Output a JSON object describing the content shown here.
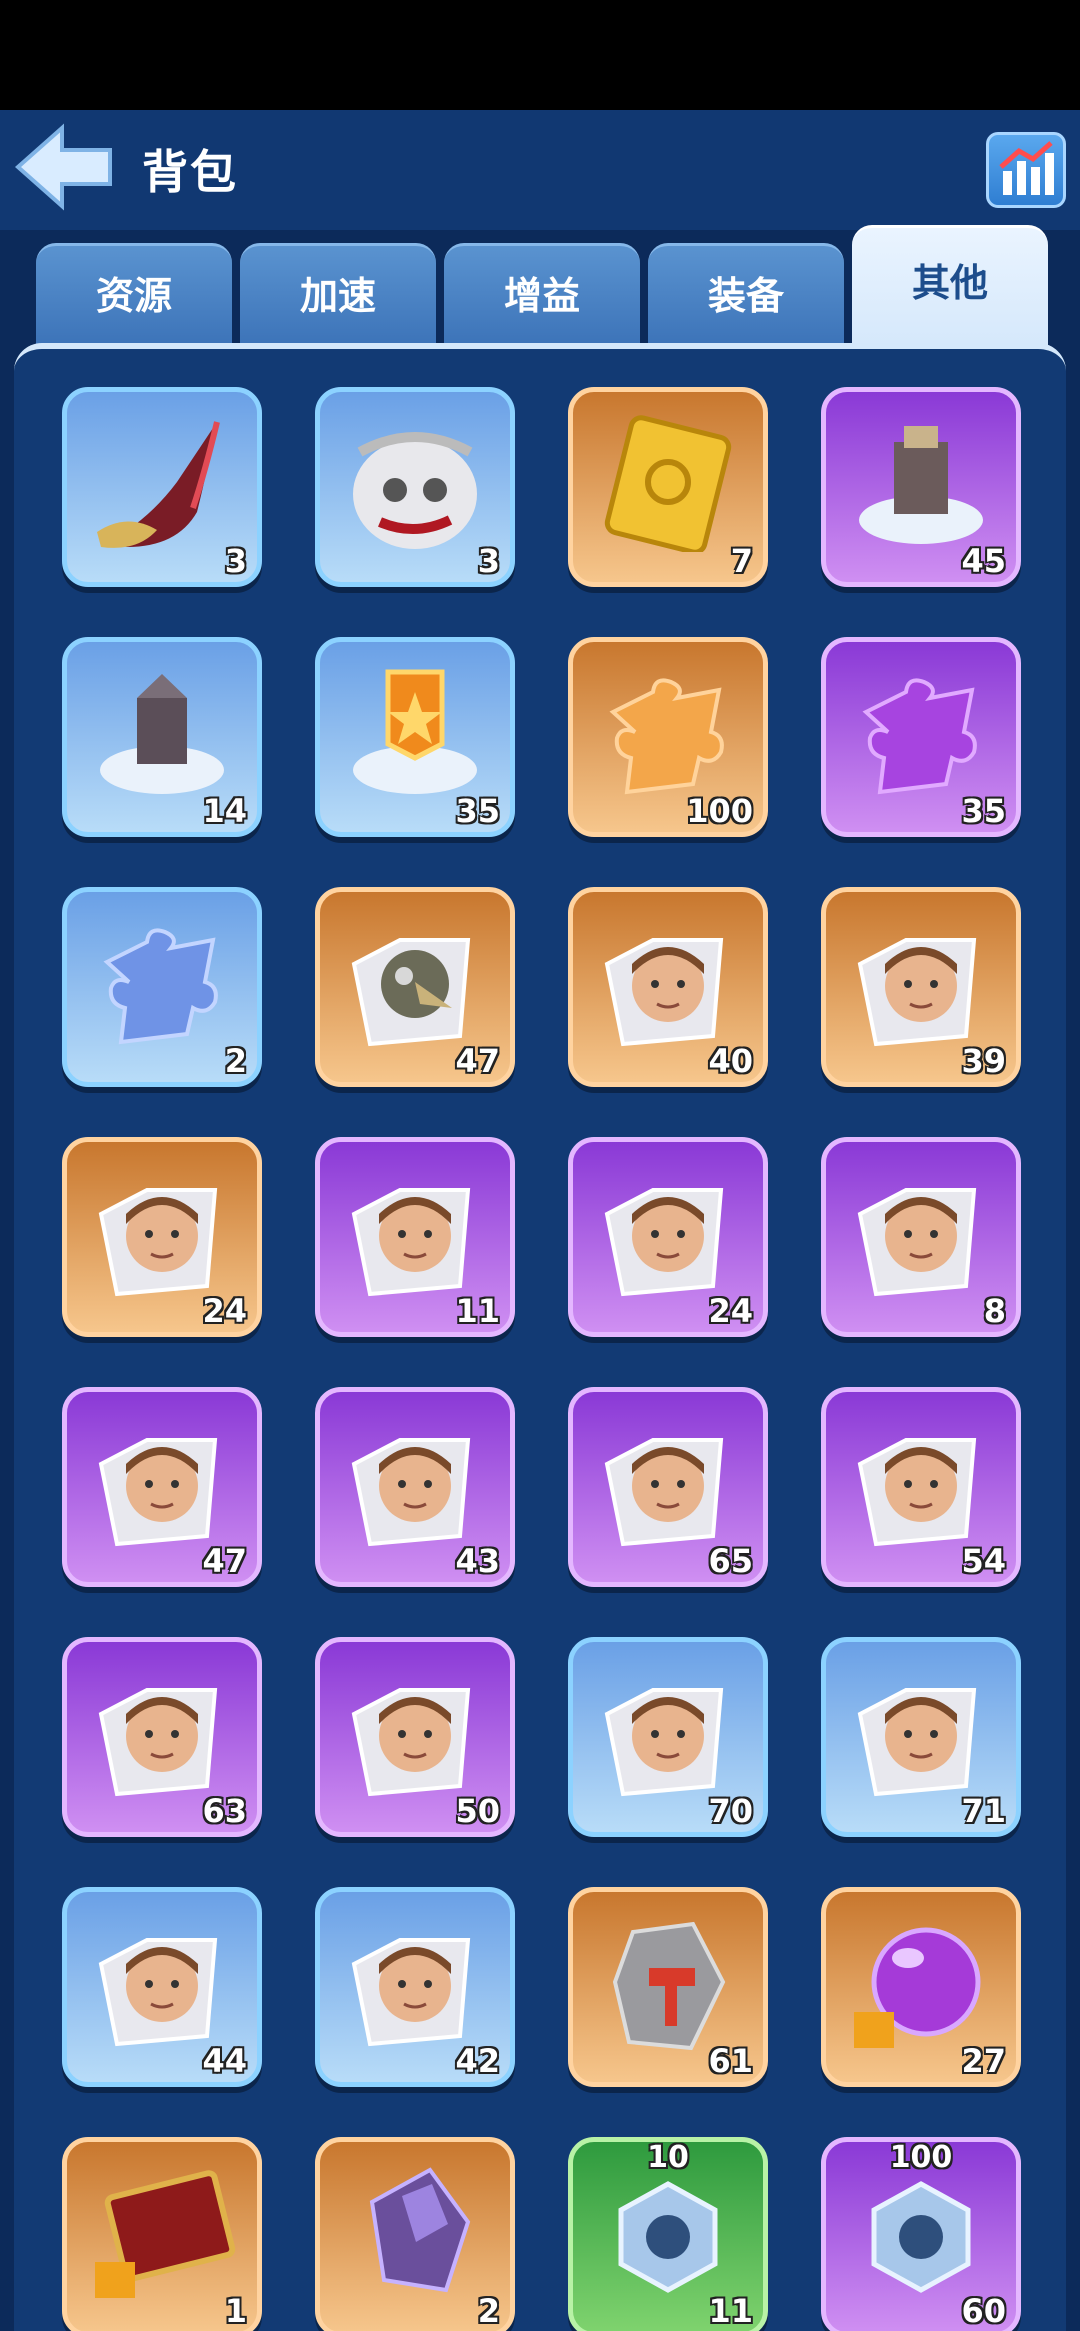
{
  "header": {
    "title": "背包"
  },
  "tabs": [
    {
      "label": "资源"
    },
    {
      "label": "加速"
    },
    {
      "label": "增益"
    },
    {
      "label": "装备"
    },
    {
      "label": "其他",
      "active": true
    }
  ],
  "items": [
    {
      "icon": "horn-icon",
      "rarity": "blue",
      "count": "3"
    },
    {
      "icon": "skull-sack-icon",
      "rarity": "blue",
      "count": "3"
    },
    {
      "icon": "gold-ticket-icon",
      "rarity": "orange",
      "count": "7"
    },
    {
      "icon": "throne-relocate-icon",
      "rarity": "purple",
      "count": "45"
    },
    {
      "icon": "building-relocate-icon",
      "rarity": "blue",
      "count": "14"
    },
    {
      "icon": "banner-relocate-icon",
      "rarity": "blue",
      "count": "35"
    },
    {
      "icon": "orange-puzzle-icon",
      "rarity": "orange",
      "count": "100"
    },
    {
      "icon": "purple-puzzle-icon",
      "rarity": "purple",
      "count": "35"
    },
    {
      "icon": "blue-puzzle-icon",
      "rarity": "blue",
      "count": "2"
    },
    {
      "icon": "hero-shard-plague-doctor-icon",
      "rarity": "orange",
      "count": "47"
    },
    {
      "icon": "hero-shard-icon",
      "rarity": "orange",
      "count": "40"
    },
    {
      "icon": "hero-shard-icon",
      "rarity": "orange",
      "count": "39"
    },
    {
      "icon": "hero-shard-icon",
      "rarity": "orange",
      "count": "24"
    },
    {
      "icon": "hero-shard-icon",
      "rarity": "purple",
      "count": "11"
    },
    {
      "icon": "hero-shard-icon",
      "rarity": "purple",
      "count": "24"
    },
    {
      "icon": "hero-shard-icon",
      "rarity": "purple",
      "count": "8"
    },
    {
      "icon": "hero-shard-icon",
      "rarity": "purple",
      "count": "47"
    },
    {
      "icon": "hero-shard-icon",
      "rarity": "purple",
      "count": "43"
    },
    {
      "icon": "hero-shard-icon",
      "rarity": "purple",
      "count": "65"
    },
    {
      "icon": "hero-shard-icon",
      "rarity": "purple",
      "count": "54"
    },
    {
      "icon": "hero-shard-icon",
      "rarity": "purple",
      "count": "63"
    },
    {
      "icon": "hero-shard-icon",
      "rarity": "purple",
      "count": "50"
    },
    {
      "icon": "hero-shard-icon",
      "rarity": "blue",
      "count": "70"
    },
    {
      "icon": "hero-shard-icon",
      "rarity": "blue",
      "count": "71"
    },
    {
      "icon": "hero-shard-icon",
      "rarity": "blue",
      "count": "44"
    },
    {
      "icon": "hero-shard-icon",
      "rarity": "blue",
      "count": "42"
    },
    {
      "icon": "hammer-stone-icon",
      "rarity": "orange",
      "count": "61"
    },
    {
      "icon": "purple-orb-icon",
      "rarity": "orange",
      "count": "27"
    },
    {
      "icon": "red-book-icon",
      "rarity": "orange",
      "count": "1"
    },
    {
      "icon": "purple-crystal-icon",
      "rarity": "orange",
      "count": "2"
    },
    {
      "icon": "hex-bolt-icon",
      "rarity": "green",
      "count": "11",
      "top": "10"
    },
    {
      "icon": "hex-bolt-icon",
      "rarity": "purple",
      "count": "60",
      "top": "100"
    }
  ],
  "colors": {
    "blue": "#6aa0e6",
    "orange": "#e3964c",
    "purple": "#a95ee2",
    "green": "#4db552"
  }
}
